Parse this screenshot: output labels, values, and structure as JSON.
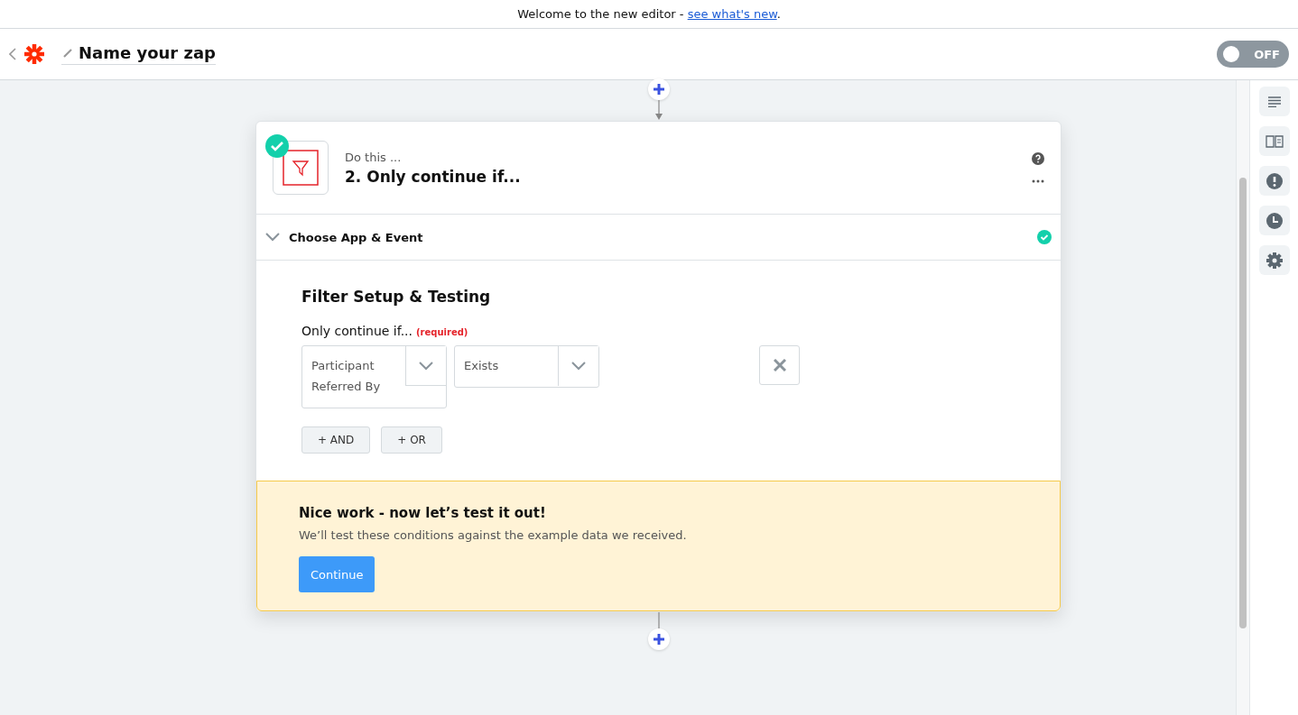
{
  "banner": {
    "text": "Welcome to the new editor - ",
    "link": "see what's new",
    "suffix": "."
  },
  "header": {
    "zap_name": "Name your zap",
    "toggle": {
      "on": false,
      "label": "OFF"
    }
  },
  "step": {
    "completed": true,
    "eyebrow": "Do this ...",
    "title": "2. Only continue if..."
  },
  "section": {
    "title": "Choose App & Event",
    "expanded": true,
    "completed": true
  },
  "filter": {
    "heading": "Filter Setup & Testing",
    "label": "Only continue if...",
    "required": "(required)",
    "conditions": [
      {
        "field": "Participant Referred By",
        "operator": "Exists"
      }
    ],
    "buttons": [
      "+ AND",
      "+ OR"
    ]
  },
  "test_panel": {
    "title": "Nice work - now let’s test it out!",
    "text": "We’ll test these conditions against the example data we received.",
    "button": "Continue"
  }
}
